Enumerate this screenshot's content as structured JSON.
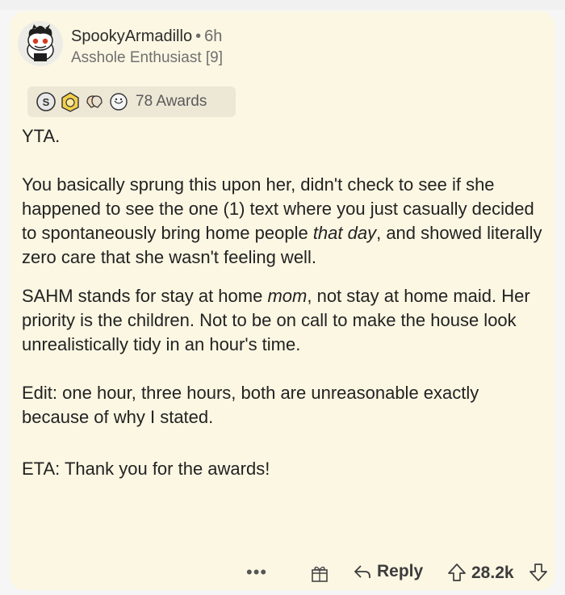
{
  "comment": {
    "author": "SpookyArmadillo",
    "separator": "•",
    "time": "6h",
    "flair": "Asshole Enthusiast [9]",
    "awards_label": "78 Awards",
    "award_icons": [
      "silver-award-icon",
      "helpful-award-icon",
      "wholesome-award-icon",
      "hugz-award-icon"
    ],
    "body": {
      "p1": "YTA.",
      "p2_a": "You basically sprung this upon her, didn't check to see if she happened to see the one (1) text where you just casually decided to spontaneously bring home people ",
      "p2_em": "that day",
      "p2_b": ", and showed literally zero care that she wasn't feeling well.",
      "p3_a": "SAHM stands for stay at home ",
      "p3_em": "mom",
      "p3_b": ", not stay at home maid. Her priority is the children. Not to be on call to make the house look unrealistically tidy in an hour's time.",
      "p4": "Edit: one hour, three hours, both are unreasonable exactly because of why I stated.",
      "p5": "ETA: Thank you for the awards!"
    },
    "footer": {
      "more": "•••",
      "reply_label": "Reply",
      "score": "28.2k"
    }
  },
  "colors": {
    "card_background": "#fcf7e3",
    "awards_background": "#ede8d6",
    "text": "#222222",
    "muted": "#707070"
  }
}
